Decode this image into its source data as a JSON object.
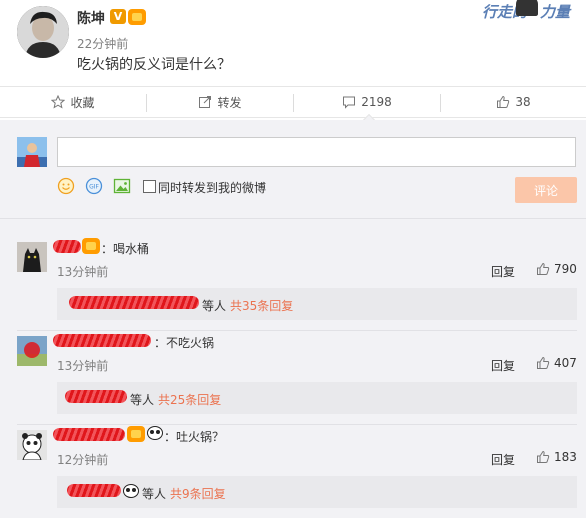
{
  "post": {
    "author": "陈坤",
    "verified_badge": "V",
    "time": "22分钟前",
    "text": "吃火锅的反义词是什么？",
    "watermark_left": "行走的",
    "watermark_right": "力量"
  },
  "actions": {
    "favorite_label": "收藏",
    "repost_label": "转发",
    "comment_count": "2198",
    "like_count": "38"
  },
  "composer": {
    "input_value": "",
    "repost_checkbox_label": "同时转发到我的微博",
    "submit_label": "评论"
  },
  "comments": [
    {
      "text": "：喝水桶",
      "time": "13分钟前",
      "reply_label": "回复",
      "likes": "790",
      "sub_suffix": "等人",
      "sub_count": "共35条回复"
    },
    {
      "text": "：不吃火锅",
      "time": "13分钟前",
      "reply_label": "回复",
      "likes": "407",
      "sub_suffix": "等人",
      "sub_count": "共25条回复"
    },
    {
      "text": "：吐火锅？",
      "time": "12分钟前",
      "reply_label": "回复",
      "likes": "183",
      "sub_suffix": "等人",
      "sub_count": "共9条回复"
    }
  ],
  "colors": {
    "accent_orange": "#eb7350",
    "submit_disabled": "#fbc6a9",
    "panel_bg": "#f2f2f5",
    "redaction_red": "#e0161b"
  }
}
